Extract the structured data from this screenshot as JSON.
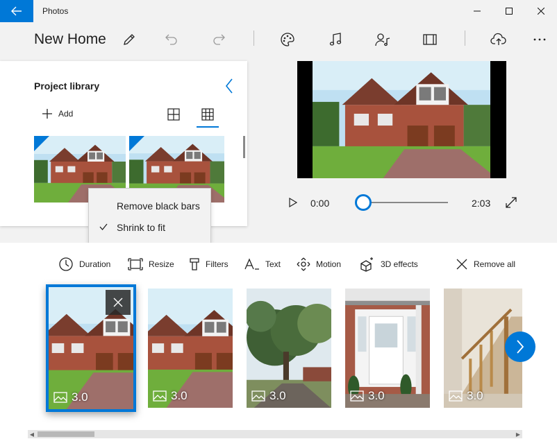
{
  "window": {
    "app_title": "Photos",
    "controls": [
      "minimize-icon",
      "maximize-icon",
      "close-icon"
    ]
  },
  "toolbar": {
    "project_title": "New Home",
    "icons": [
      "pencil-icon",
      "undo-icon",
      "redo-icon",
      "palette-icon",
      "music-icon",
      "custom-audio-icon",
      "aspect-ratio-icon",
      "cloud-upload-icon",
      "more-icon"
    ]
  },
  "library": {
    "title": "Project library",
    "add_label": "Add",
    "views": [
      "large-grid-icon",
      "small-grid-icon"
    ]
  },
  "context_menu": {
    "items": [
      {
        "label": "Remove black bars",
        "checked": false
      },
      {
        "label": "Shrink to fit",
        "checked": true
      }
    ]
  },
  "player": {
    "current_time": "0:00",
    "total_time": "2:03",
    "progress": 0
  },
  "storyboard": {
    "tools": [
      {
        "label": "Duration",
        "icon": "clock-icon"
      },
      {
        "label": "Resize",
        "icon": "resize-icon"
      },
      {
        "label": "Filters",
        "icon": "filter-icon"
      },
      {
        "label": "Text",
        "icon": "text-icon"
      },
      {
        "label": "Motion",
        "icon": "motion-icon"
      },
      {
        "label": "3D effects",
        "icon": "3d-effects-icon"
      }
    ],
    "remove_all_label": "Remove all",
    "clips": [
      {
        "duration": "3.0",
        "scene": "house",
        "selected": true
      },
      {
        "duration": "3.0",
        "scene": "house",
        "selected": false
      },
      {
        "duration": "3.0",
        "scene": "tree",
        "selected": false
      },
      {
        "duration": "3.0",
        "scene": "door",
        "selected": false
      },
      {
        "duration": "3.0",
        "scene": "stairs",
        "selected": false
      }
    ]
  },
  "colors": {
    "accent": "#0078d7",
    "background": "#f2f2f2",
    "panel": "#ffffff"
  }
}
